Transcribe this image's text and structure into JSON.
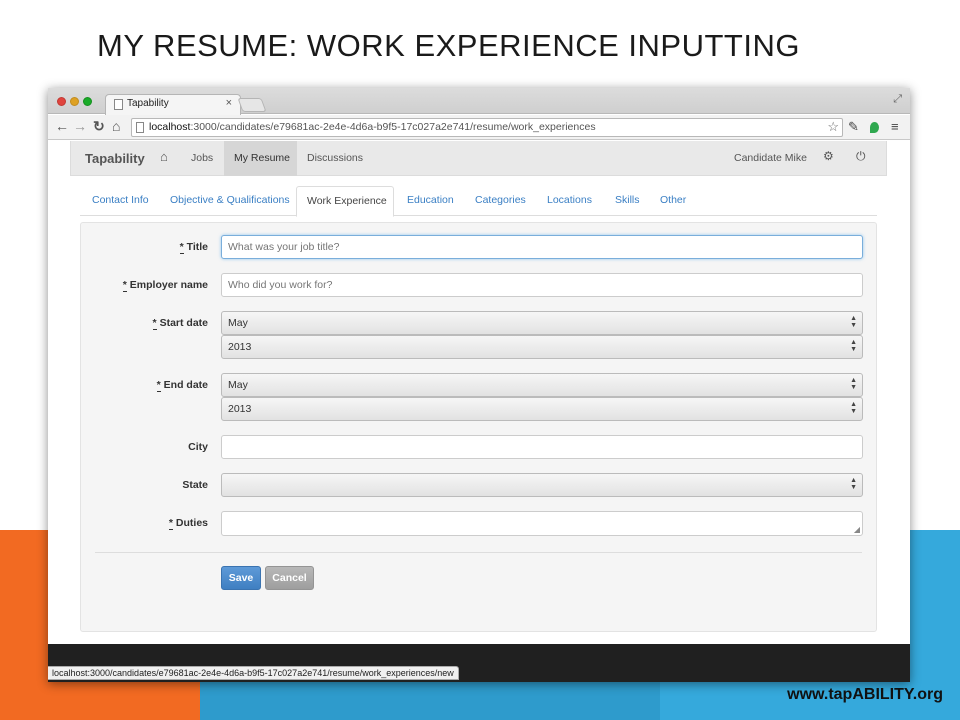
{
  "slide": {
    "title": "MY RESUME: WORK EXPERIENCE INPUTTING",
    "footer_url": "www.tapABILITY.org"
  },
  "browser": {
    "tab_title": "Tapability",
    "tab_close": "×",
    "url_host": "localhost",
    "url_path": ":3000/candidates/e79681ac-2e4e-4d6a-b9f5-17c027a2e741/resume/work_experiences",
    "status_url": "localhost:3000/candidates/e79681ac-2e4e-4d6a-b9f5-17c027a2e741/resume/work_experiences/new"
  },
  "app_nav": {
    "brand": "Tapability",
    "links": [
      "Jobs",
      "My Resume",
      "Discussions"
    ],
    "active": "My Resume",
    "user": "Candidate Mike"
  },
  "sub_tabs": [
    "Contact Info",
    "Objective & Qualifications",
    "Work Experience",
    "Education",
    "Categories",
    "Locations",
    "Skills",
    "Other"
  ],
  "active_sub_tab": "Work Experience",
  "form": {
    "title_label": "Title",
    "title_placeholder": "What was your job title?",
    "employer_label": "Employer name",
    "employer_placeholder": "Who did you work for?",
    "start_label": "Start date",
    "start_month": "May",
    "start_year": "2013",
    "end_label": "End date",
    "end_month": "May",
    "end_year": "2013",
    "city_label": "City",
    "city_value": "",
    "state_label": "State",
    "state_value": "",
    "duties_label": "Duties",
    "required_marker": "*",
    "save_label": "Save",
    "cancel_label": "Cancel"
  },
  "colors": {
    "accent_blue": "#3a7fc4",
    "save_button": "#4a8acb",
    "slide_orange": "#f26a22",
    "slide_blue": "#35a9dc"
  }
}
